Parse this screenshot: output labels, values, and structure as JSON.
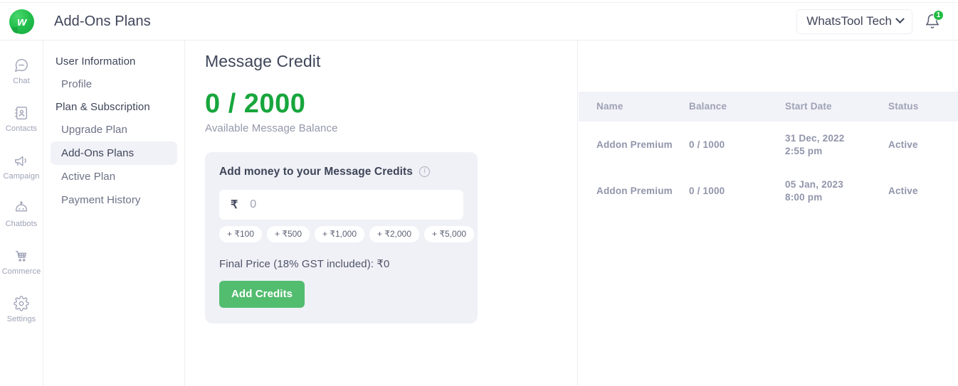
{
  "header": {
    "logo_alt": "whatstool-logo",
    "logo_letter": "w",
    "title": "Add-Ons Plans",
    "org_name": "WhatsTool Tech",
    "notification_count": "1"
  },
  "rail": {
    "items": [
      {
        "label": "Chat",
        "icon": "chat-icon"
      },
      {
        "label": "Contacts",
        "icon": "contacts-icon"
      },
      {
        "label": "Campaign",
        "icon": "campaign-icon"
      },
      {
        "label": "Chatbots",
        "icon": "chatbots-icon"
      },
      {
        "label": "Commerce",
        "icon": "commerce-icon"
      },
      {
        "label": "Settings",
        "icon": "settings-icon"
      }
    ]
  },
  "subnav": {
    "group1_label": "User Information",
    "group1_items": [
      {
        "label": "Profile",
        "active": false
      }
    ],
    "group2_label": "Plan & Subscription",
    "group2_items": [
      {
        "label": "Upgrade Plan",
        "active": false
      },
      {
        "label": "Add-Ons Plans",
        "active": true
      },
      {
        "label": "Active Plan",
        "active": false
      },
      {
        "label": "Payment History",
        "active": false
      }
    ]
  },
  "main": {
    "page_title": "Message Credit",
    "credit_value": "0 / 2000",
    "credit_caption": "Available Message Balance",
    "credit_color": "#17a63c",
    "add_card": {
      "title": "Add money to your Message Credits",
      "info_icon": "info-icon",
      "currency_symbol": "₹",
      "amount_value": "0",
      "amount_placeholder": "0",
      "chips": [
        "+ ₹100",
        "+ ₹500",
        "+ ₹1,000",
        "+ ₹2,000",
        "+ ₹5,000"
      ],
      "final_price_label": "Final Price (18% GST included): ₹0",
      "submit_label": "Add Credits",
      "submit_color": "#53bd6f"
    }
  },
  "table": {
    "columns": [
      "Name",
      "Balance",
      "Start Date",
      "Status"
    ],
    "rows": [
      {
        "name": "Addon Premium",
        "balance": "0 / 1000",
        "date_line1": "31 Dec, 2022",
        "date_line2": "2:55 pm",
        "status": "Active"
      },
      {
        "name": "Addon Premium",
        "balance": "0 / 1000",
        "date_line1": "05 Jan, 2023",
        "date_line2": "8:00 pm",
        "status": "Active"
      }
    ]
  }
}
